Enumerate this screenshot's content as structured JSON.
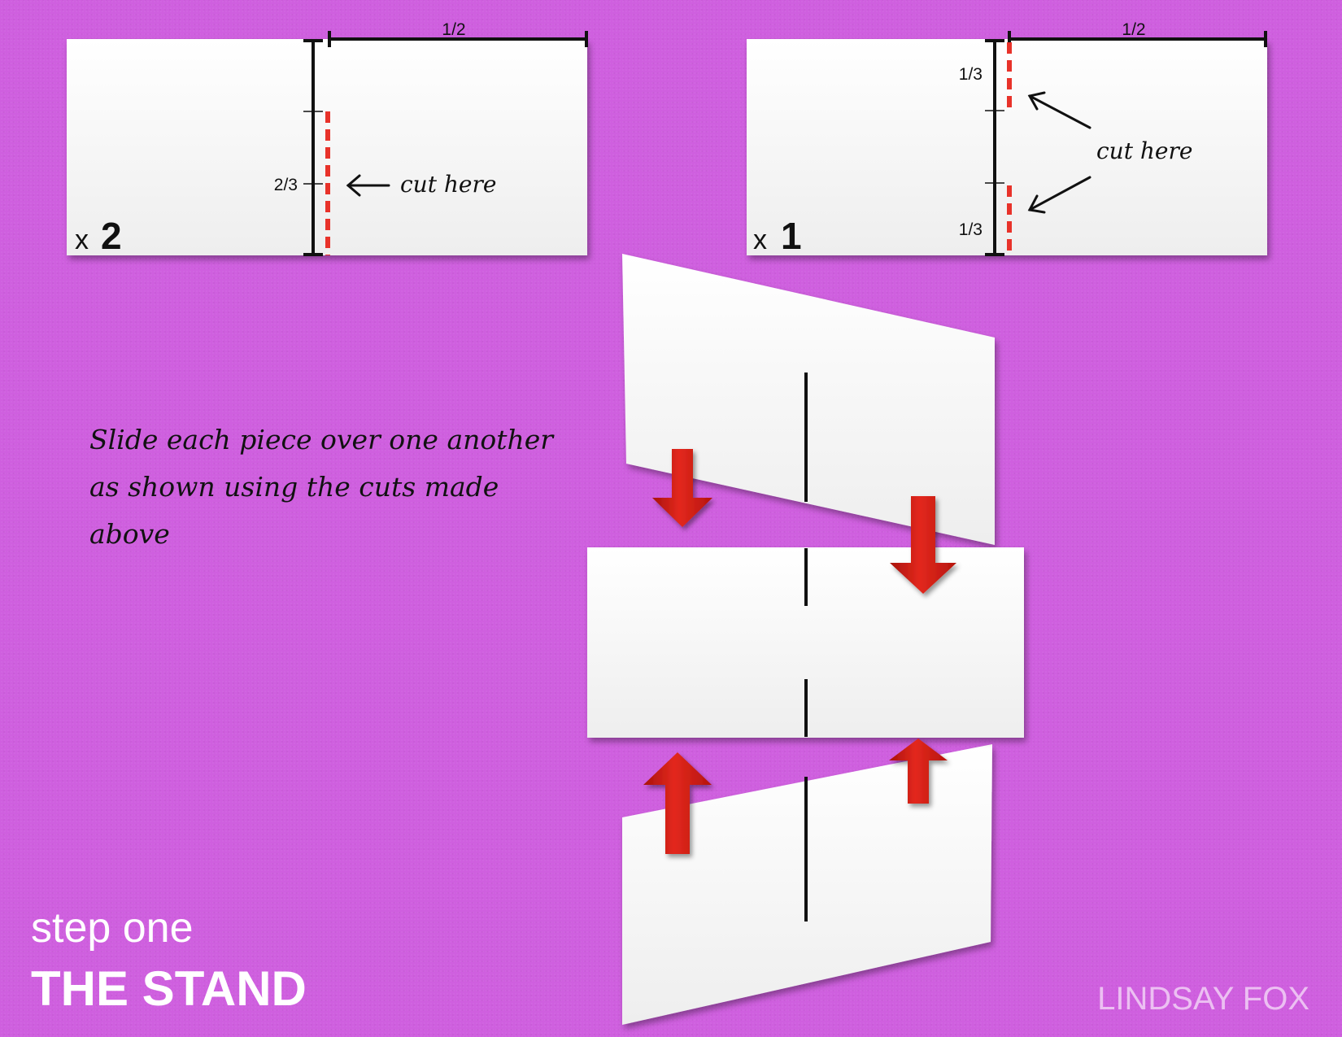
{
  "title": {
    "step": "step one",
    "name": "THE STAND"
  },
  "author": "LINDSAY FOX",
  "instructions": "Slide each piece over one another as shown using the cuts made above",
  "pieces": [
    {
      "multiplier_prefix": "x",
      "multiplier_count": "2",
      "half_label": "1/2",
      "length_label": "2/3",
      "cut_label": "cut here"
    },
    {
      "multiplier_prefix": "x",
      "multiplier_count": "1",
      "half_label": "1/2",
      "top_third_label": "1/3",
      "bottom_third_label": "1/3",
      "cut_label": "cut here"
    }
  ],
  "colors": {
    "background": "#cf5fdf",
    "card": "#ffffff",
    "cut_line": "#e8322a",
    "arrow": "#d81e14",
    "ink": "#111111"
  },
  "icons": [
    "left-arrow-icon",
    "diagonal-arrow-icon",
    "down-arrow-icon",
    "up-arrow-icon"
  ]
}
